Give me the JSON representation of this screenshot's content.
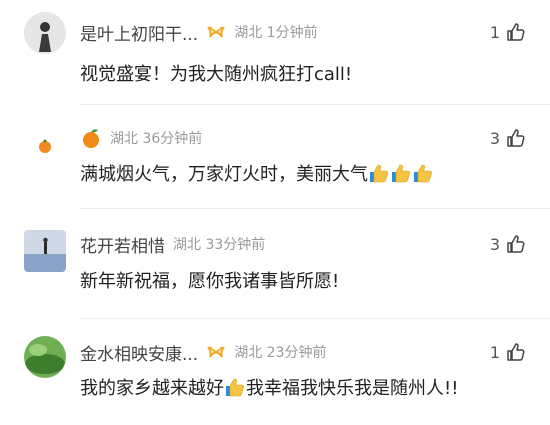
{
  "comments": [
    {
      "name": "是叶上初阳干...",
      "location": "湖北 1分钟前",
      "likes": "1",
      "text_before": "视觉盛宴！为我大随州疯狂打call!",
      "text_after": ""
    },
    {
      "name": "",
      "location": "湖北 36分钟前",
      "likes": "3",
      "text_before": "满城烟火气，万家灯火时，美丽大气",
      "text_after": ""
    },
    {
      "name": "花开若相惜",
      "location": "湖北 33分钟前",
      "likes": "3",
      "text_before": "新年新祝福，愿你我诸事皆所愿!",
      "text_after": ""
    },
    {
      "name": "金水相映安康...",
      "location": "湖北 23分钟前",
      "likes": "1",
      "text_before": "我的家乡越来越好",
      "text_after": "我幸福我快乐我是随州人!!"
    }
  ]
}
